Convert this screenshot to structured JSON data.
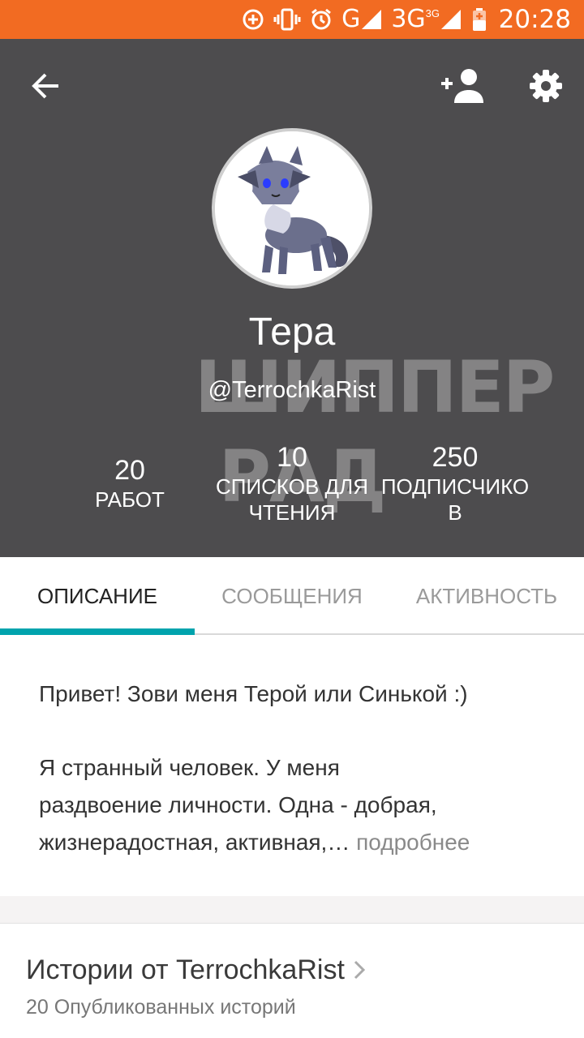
{
  "status_bar": {
    "network_label": "G",
    "network_label_2": "3G",
    "network_sup": "3G",
    "time": "20:28",
    "icons": [
      "data-saver-icon",
      "vibrate-icon",
      "alarm-icon",
      "signal-icon",
      "signal-icon",
      "battery-charging-icon"
    ]
  },
  "header": {
    "background": "#4d4c4e",
    "actions": [
      "back-arrow-icon",
      "add-user-icon",
      "gear-icon"
    ]
  },
  "profile": {
    "name": "Тера",
    "handle": "@TerrochkaRist",
    "watermark_line1": "ШИППЕР",
    "watermark_line2": "РАД"
  },
  "stats": {
    "works": {
      "value": "20",
      "label": "Работ"
    },
    "reading_lists": {
      "value": "10",
      "label_line1": "Списков для",
      "label_line2": "чтения"
    },
    "followers": {
      "value": "250",
      "label_line1": "подписчико",
      "label_line2": "в"
    }
  },
  "tabs": [
    {
      "label": "Описание",
      "active": true
    },
    {
      "label": "Сообщения",
      "active": false
    },
    {
      "label": "Активность",
      "active": false
    }
  ],
  "accent_color": "#00a3ad",
  "about": {
    "greeting": "Привет! Зови меня Терой или Синькой :)",
    "line1": "Я странный человек. У меня",
    "line2": "раздвоение личности. Одна - добрая,",
    "line3": "жизнерадостная, активная,…",
    "more": "подробнее"
  },
  "stories": {
    "title": "Истории от TerrochkaRist",
    "subtitle": "20 Опубликованных историй"
  }
}
